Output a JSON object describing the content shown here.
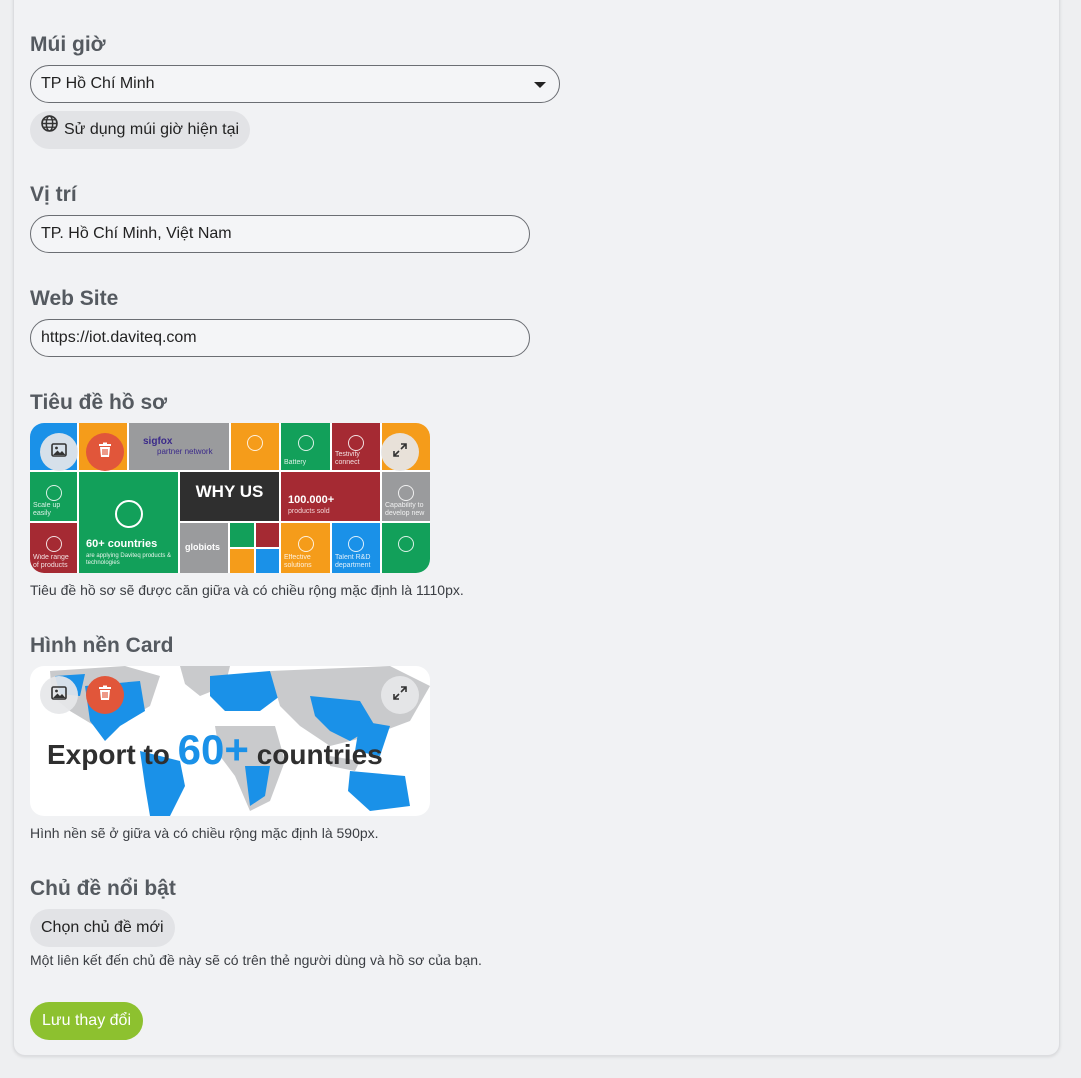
{
  "timezone": {
    "label": "Múi giờ",
    "value": "TP Hồ Chí Minh",
    "use_current_label": "Sử dụng múi giờ hiện tại"
  },
  "location": {
    "label": "Vị trí",
    "value": "TP. Hồ Chí Minh, Việt Nam"
  },
  "website": {
    "label": "Web Site",
    "value": "https://iot.daviteq.com"
  },
  "profile_header": {
    "label": "Tiêu đề hồ sơ",
    "help": "Tiêu đề hồ sơ sẽ được căn giữa và có chiều rộng mặc định là 1110px.",
    "image_text": {
      "brand_top": "sigfox",
      "brand_bottom": "partner network",
      "why_us": "WHY US",
      "big_number": "100.000+",
      "big_number_sub": "products sold",
      "countries": "60+ countries",
      "countries_sub": "are applying Daviteq products & technologies",
      "globiots": "globiots",
      "tiles": [
        "Battery",
        "Scale up easily",
        "Wide range of products",
        "Capability to develop new",
        "Effective solutions",
        "Talent R&D department",
        "Testivity connect"
      ]
    }
  },
  "card_background": {
    "label": "Hình nền Card",
    "help": "Hình nền sẽ ở giữa và có chiều rộng mặc định là 590px.",
    "image_text": {
      "export": "Export to",
      "number": "60+",
      "countries": "countries"
    }
  },
  "featured_topic": {
    "label": "Chủ đề nổi bật",
    "button": "Chọn chủ đề mới",
    "help": "Một liên kết đến chủ đề này sẽ có trên thẻ người dùng và hồ sơ của bạn."
  },
  "save_button": "Lưu thay đổi",
  "colors": {
    "accent_green": "#8dc12f",
    "delete_red": "#e1563a",
    "map_blue": "#1a91e8"
  }
}
